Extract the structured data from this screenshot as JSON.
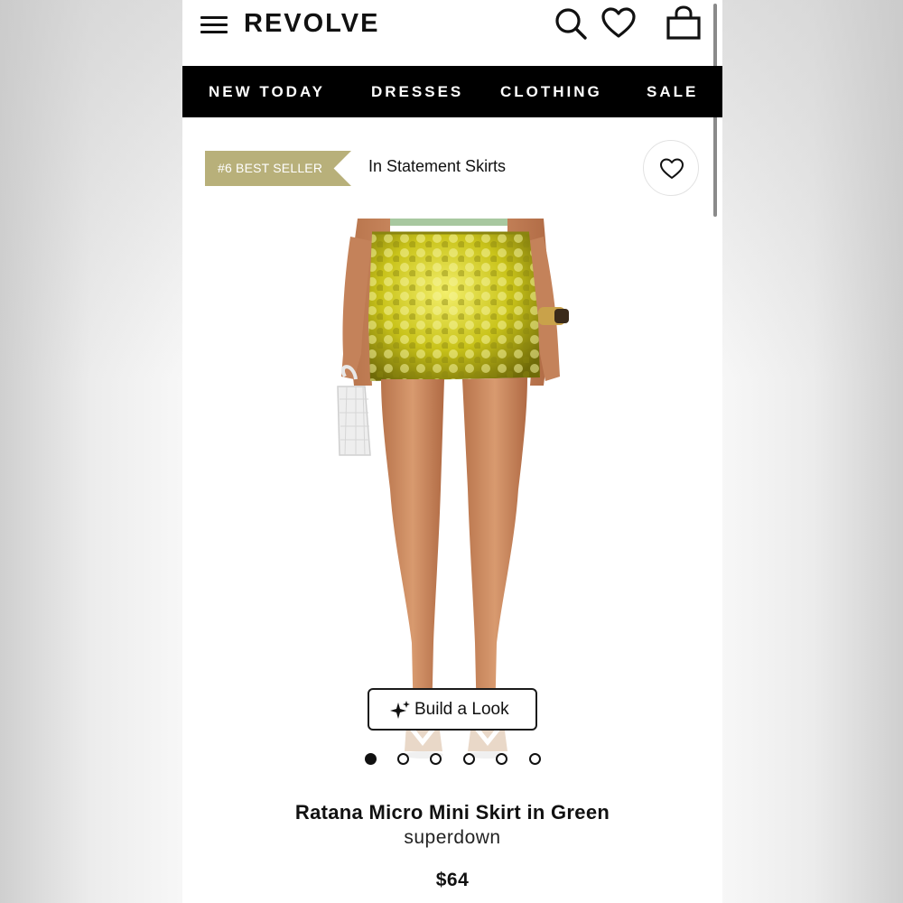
{
  "header": {
    "logo": "REVOLVE",
    "icons": [
      "menu-icon",
      "search-icon",
      "heart-icon",
      "shopping-bag-icon"
    ]
  },
  "nav": {
    "items": [
      {
        "label": "NEW TODAY"
      },
      {
        "label": "DRESSES"
      },
      {
        "label": "CLOTHING"
      },
      {
        "label": "SALE"
      }
    ]
  },
  "product": {
    "badge": "#6 BEST SELLER",
    "category": "In Statement Skirts",
    "build_look_label": "Build a Look",
    "image_count": 6,
    "active_image_index": 0,
    "name": "Ratana Micro Mini Skirt in Green",
    "brand": "superdown",
    "price": "$64"
  },
  "colors": {
    "badge": "#b8b07a",
    "nav_background": "#000000",
    "skirt": "#c9c31a"
  }
}
